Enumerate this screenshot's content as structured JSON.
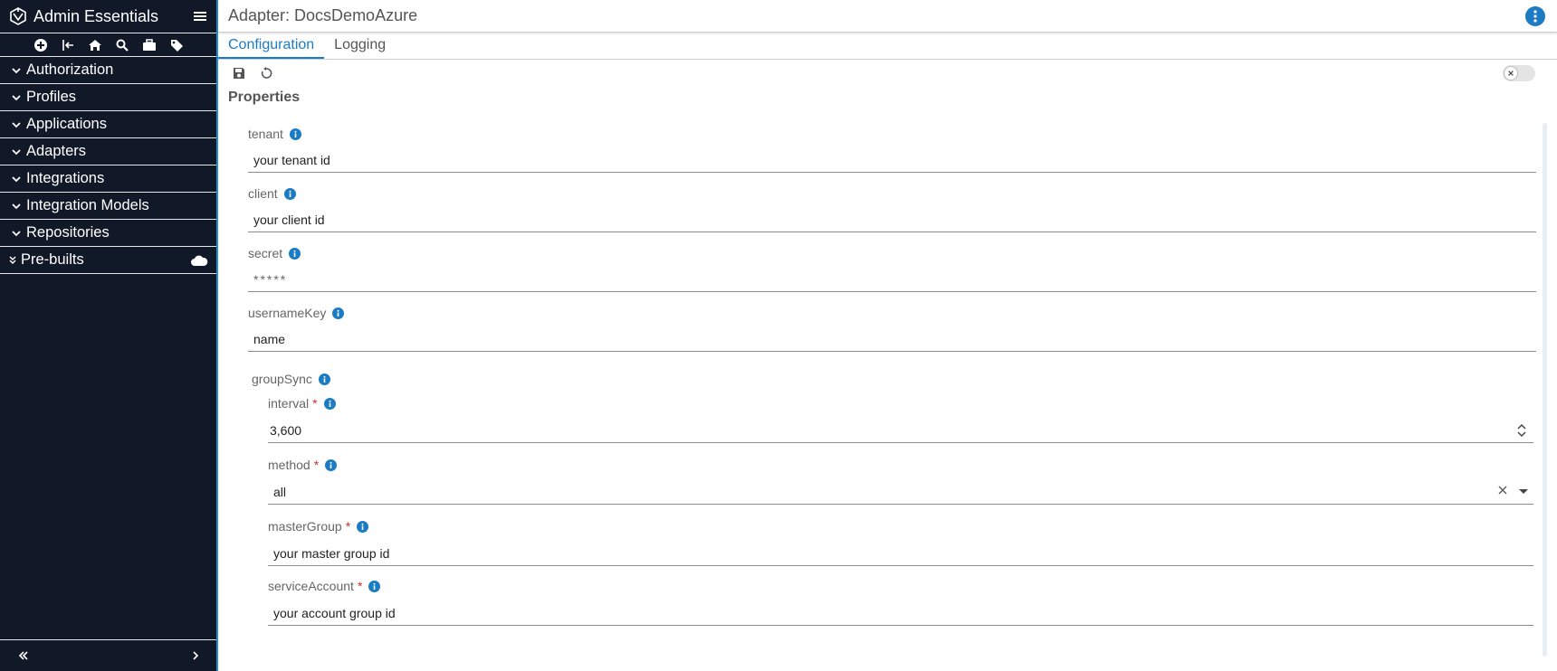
{
  "app": {
    "title": "Admin Essentials"
  },
  "sidebar": {
    "tools": [
      "add-icon",
      "logout-icon",
      "home-icon",
      "search-icon",
      "briefcase-icon",
      "tag-icon"
    ],
    "items": [
      {
        "label": "Authorization"
      },
      {
        "label": "Profiles"
      },
      {
        "label": "Applications"
      },
      {
        "label": "Adapters"
      },
      {
        "label": "Integrations"
      },
      {
        "label": "Integration Models"
      },
      {
        "label": "Repositories"
      }
    ],
    "prebuilt": {
      "label": "Pre-builts"
    }
  },
  "header": {
    "title": "Adapter: DocsDemoAzure"
  },
  "tabs": [
    {
      "label": "Configuration",
      "active": true
    },
    {
      "label": "Logging",
      "active": false
    }
  ],
  "section": {
    "title": "Properties"
  },
  "fields": {
    "tenant": {
      "label": "tenant",
      "value": "your tenant id"
    },
    "client": {
      "label": "client",
      "value": "your client id"
    },
    "secret": {
      "label": "secret",
      "value": "*****"
    },
    "usernameKey": {
      "label": "usernameKey",
      "value": "name"
    },
    "groupSync": {
      "label": "groupSync",
      "interval": {
        "label": "interval",
        "required": "*",
        "value": "3,600"
      },
      "method": {
        "label": "method",
        "required": "*",
        "value": "all"
      },
      "masterGroup": {
        "label": "masterGroup",
        "required": "*",
        "value": "your master group id"
      },
      "serviceAccount": {
        "label": "serviceAccount",
        "required": "*",
        "value": "your account group id"
      }
    }
  },
  "colors": {
    "sidebar_bg": "#111827",
    "accent": "#1b7cc4",
    "required": "#d32f2f"
  }
}
